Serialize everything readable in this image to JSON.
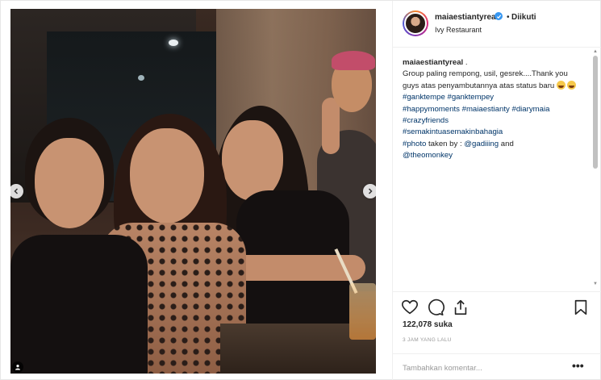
{
  "post": {
    "username": "maiaestiantyreal",
    "verified": true,
    "separator": "•",
    "follow_label": "Diikuti",
    "location": "Ivy Restaurant"
  },
  "caption": {
    "username": "maiaestiantyreal",
    "text_after_user": ".",
    "line1": "Group paling rempong, usil, gesrek....Thank you guys atas penyambutannya atas status baru",
    "hashtags_1": [
      "#ganktempe",
      "#ganktempey",
      "#happymoments",
      "#maiaestianty",
      "#diarymaia",
      "#crazyfriends",
      "#semakintuasemakinbahagia",
      "#photo"
    ],
    "taken_by_text": "taken by :",
    "mention_1": "@gadiiing",
    "and_text": "and",
    "mention_2": "@theomonkey"
  },
  "stats": {
    "likes": "122,078 suka",
    "time": "3 JAM YANG LALU"
  },
  "comment": {
    "placeholder": "Tambahkan komentar...",
    "more_label": "•••"
  },
  "icons": {
    "like": "heart-icon",
    "comment": "comment-icon",
    "share": "share-icon",
    "save": "bookmark-icon",
    "prev": "chevron-left-icon",
    "next": "chevron-right-icon",
    "tag": "user-tag-icon"
  },
  "colors": {
    "link": "#003569",
    "verified": "#3897f0",
    "muted": "#999999"
  }
}
